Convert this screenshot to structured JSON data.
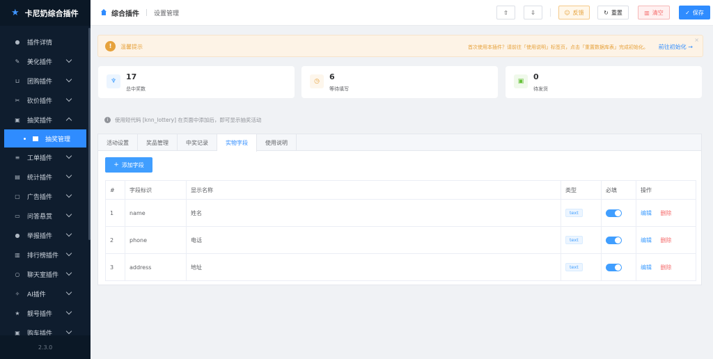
{
  "app": {
    "title": "卡尼奶综合插件",
    "version": "2.3.0"
  },
  "sidebar": {
    "items": [
      {
        "label": "插件详情",
        "icon": "info-icon"
      },
      {
        "label": "美化插件",
        "icon": "brush-icon"
      },
      {
        "label": "团购插件",
        "icon": "cart-icon"
      },
      {
        "label": "砍价插件",
        "icon": "scissors-icon"
      },
      {
        "label": "抽奖插件",
        "icon": "gift-icon"
      },
      {
        "label": "工单插件",
        "icon": "ticket-icon"
      },
      {
        "label": "统计插件",
        "icon": "chart-icon"
      },
      {
        "label": "广告插件",
        "icon": "ad-icon"
      },
      {
        "label": "问答悬赏",
        "icon": "chat-icon"
      },
      {
        "label": "举报插件",
        "icon": "report-icon"
      },
      {
        "label": "排行榜插件",
        "icon": "ranking-icon"
      },
      {
        "label": "聊天室插件",
        "icon": "chatroom-icon"
      },
      {
        "label": "AI插件",
        "icon": "ai-icon"
      },
      {
        "label": "靓号插件",
        "icon": "star-icon"
      },
      {
        "label": "购车插件",
        "icon": "car-icon"
      }
    ],
    "active_sub": "抽奖管理"
  },
  "header": {
    "breadcrumb_main": "综合插件",
    "breadcrumb_sub": "设置管理",
    "feedback_label": "反馈",
    "reset_label": "重置",
    "clear_label": "清空",
    "save_label": "保存"
  },
  "notice": {
    "title": "温馨提示",
    "message": "首次使用本插件？请前往「使用说明」标签页，点击「重置数据库表」完成初始化。",
    "link": "前往初始化 →"
  },
  "stats": [
    {
      "value": "17",
      "label": "总中奖数",
      "icon": "trophy-icon",
      "color": "#409eff"
    },
    {
      "value": "6",
      "label": "等待填写",
      "icon": "clock-icon",
      "color": "#e6a23c"
    },
    {
      "value": "0",
      "label": "待发货",
      "icon": "package-icon",
      "color": "#67c23a"
    }
  ],
  "info_text": "使用短代码 [knn_lottery] 在页面中添加后，即可显示抽奖活动",
  "tabs": [
    "活动设置",
    "奖品管理",
    "中奖记录",
    "实物字段",
    "使用说明"
  ],
  "active_tab": "实物字段",
  "add_field_label": "添加字段",
  "table": {
    "headers": [
      "#",
      "字段标识",
      "显示名称",
      "类型",
      "必填",
      "操作"
    ],
    "rows": [
      {
        "idx": "1",
        "key": "name",
        "name": "姓名",
        "type": "text",
        "required": true
      },
      {
        "idx": "2",
        "key": "phone",
        "name": "电话",
        "type": "text",
        "required": true
      },
      {
        "idx": "3",
        "key": "address",
        "name": "地址",
        "type": "text",
        "required": true
      }
    ],
    "edit_label": "编辑",
    "delete_label": "删除"
  }
}
